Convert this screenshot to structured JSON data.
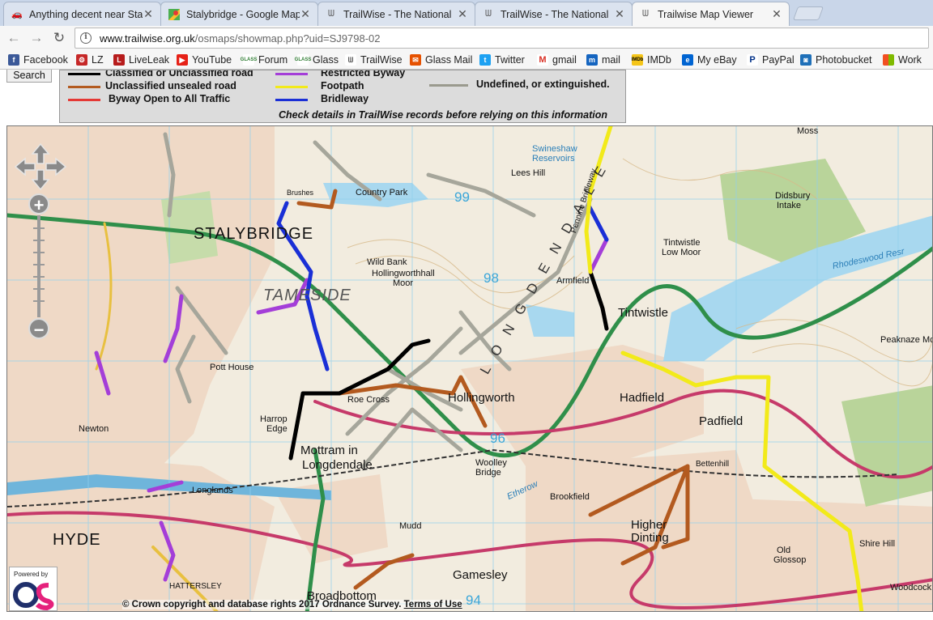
{
  "tabs": [
    {
      "title": "Anything decent near Sta",
      "icon": "car-icon",
      "active": false
    },
    {
      "title": "Stalybridge - Google Map",
      "icon": "google-maps-icon",
      "active": false
    },
    {
      "title": "TrailWise - The National",
      "icon": "trailwise-icon",
      "active": false
    },
    {
      "title": "TrailWise - The National",
      "icon": "trailwise-icon",
      "active": false
    },
    {
      "title": "Trailwise Map Viewer",
      "icon": "trailwise-icon",
      "active": true
    }
  ],
  "address": {
    "host": "www.trailwise.org.uk",
    "path": "/osmaps/showmap.php?uid=SJ9798-02"
  },
  "bookmarks": [
    {
      "label": "Facebook",
      "icon": "facebook-icon",
      "color": "#3b5998"
    },
    {
      "label": "LZ",
      "icon": "lz-icon",
      "color": "#c62828"
    },
    {
      "label": "LiveLeak",
      "icon": "liveleak-icon",
      "color": "#b71c1c"
    },
    {
      "label": "YouTube",
      "icon": "youtube-icon",
      "color": "#e62117"
    },
    {
      "label": "Forum",
      "icon": "glass-forum-icon",
      "color": "#2e7d32"
    },
    {
      "label": "Glass",
      "icon": "glass-icon",
      "color": "#2e7d32"
    },
    {
      "label": "TrailWise",
      "icon": "trailwise-icon",
      "color": "#555555"
    },
    {
      "label": "Glass Mail",
      "icon": "glass-mail-icon",
      "color": "#e65100"
    },
    {
      "label": "Twitter",
      "icon": "twitter-icon",
      "color": "#1da1f2"
    },
    {
      "label": "gmail",
      "icon": "gmail-icon",
      "color": "#d93025"
    },
    {
      "label": "mail",
      "icon": "mail-icon",
      "color": "#1565c0"
    },
    {
      "label": "IMDb",
      "icon": "imdb-icon",
      "color": "#f5c518"
    },
    {
      "label": "My eBay",
      "icon": "ebay-icon",
      "color": "#0064d2"
    },
    {
      "label": "PayPal",
      "icon": "paypal-icon",
      "color": "#003087"
    },
    {
      "label": "Photobucket",
      "icon": "photobucket-icon",
      "color": "#1e6fb8"
    },
    {
      "label": "Work",
      "icon": "windows-icon",
      "color": "#f25022"
    }
  ],
  "page": {
    "search_label": "Search",
    "legend": {
      "items": [
        {
          "label": "Classified or Unclassified road",
          "color": "#000000"
        },
        {
          "label": "Unclassified unsealed road",
          "color": "#b35a1f"
        },
        {
          "label": "Byway Open to All Traffic",
          "color": "#e53935"
        },
        {
          "label": "Restricted Byway",
          "color": "#a43ed8"
        },
        {
          "label": "Footpath",
          "color": "#f2ea1a"
        },
        {
          "label": "Bridleway",
          "color": "#1a2fd6"
        },
        {
          "label": "Undefined, or extinguished.",
          "color": "#9a9a8e"
        }
      ],
      "note": "Check details in TrailWise records before relying on this information"
    }
  },
  "map": {
    "places": {
      "stalybridge": "STALYBRIDGE",
      "tameside": "TAMESIDE",
      "hyde": "HYDE",
      "hollingworth": "Hollingworth",
      "hadfield": "Hadfield",
      "padfield": "Padfield",
      "tintwistle": "Tintwistle",
      "mottram": "Mottram in",
      "longdendale": "Longdendale",
      "broadbottom": "Broadbottom",
      "gamesley": "Gamesley",
      "higher_dinting": "Higher",
      "dinting": "Dinting",
      "armfield": "Armfield",
      "moss": "Moss",
      "lees_hill": "Lees Hill",
      "pott_house": "Pott House",
      "harrop_edge": "Harrop",
      "edge": "Edge",
      "roe_cross": "Roe Cross",
      "country_park": "Country Park",
      "brushes": "Brushes",
      "newton": "Newton",
      "woolley_bridge": "Woolley",
      "bridge": "Bridge",
      "brookfield": "Brookfield",
      "shire_hill": "Shire Hill",
      "old_glossop": "Old",
      "glossop": "Glossop",
      "peaknaze_moor": "Peaknaze Mo",
      "didsbury_intake": "Didsbury",
      "intake": "Intake",
      "tintwistle_low_moor": "Tintwistle",
      "low_moor": "Low Moor",
      "rhodeswood": "Rhodeswood Resr",
      "swineshaw": "Swineshaw",
      "reservoirs": "Reservoirs",
      "hollingworthhall": "Hollingworthhall",
      "moor": "Moor",
      "wild_bank": "Wild Bank",
      "longlands": "Longlands",
      "hattersley": "HATTERSLEY",
      "mudd": "Mudd",
      "woodcock": "Woodcock",
      "padfield_label": "Padfield",
      "bettenhill": "Bettenhill",
      "longdendale_side": "L O N G D E N D A L E",
      "pennine_bridleway": "Pennine Bridleway",
      "etherow": "Etherow"
    },
    "grid_labels": [
      "99",
      "98",
      "96",
      "94"
    ],
    "copyright_text": "© Crown copyright and database rights 2017 Ordnance Survey.",
    "terms_link": "Terms of Use",
    "powered_by": "Powered by",
    "controls": {
      "zoom_in": "+",
      "zoom_out": "−"
    }
  }
}
